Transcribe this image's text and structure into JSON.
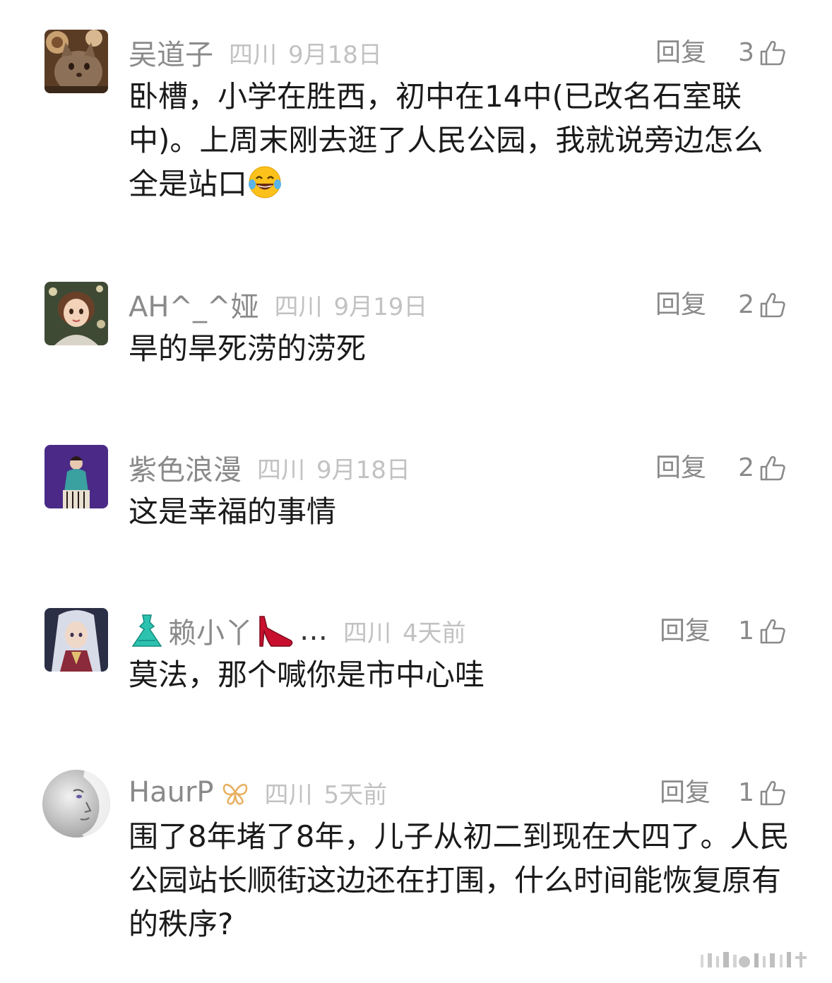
{
  "actions": {
    "reply_label": "回复"
  },
  "comments": [
    {
      "username": "吴道子",
      "location": "四川",
      "date": "9月18日",
      "likes": "3",
      "text": "卧槽，小学在胜西，初中在14中(已改名石室联中)。上周末刚去逛了人民公园，我就说旁边怎么全是站口",
      "emoji": "joy-tears-emoji",
      "avatar": "cat-avatar"
    },
    {
      "username": "AH^_^娅",
      "location": "四川",
      "date": "9月19日",
      "likes": "2",
      "text": "旱的旱死涝的涝死",
      "avatar": "girl-avatar"
    },
    {
      "username": "紫色浪漫",
      "location": "四川",
      "date": "9月18日",
      "likes": "2",
      "text": "这是幸福的事情",
      "avatar": "purple-portrait-avatar"
    },
    {
      "username": "赖小丫",
      "username_prefix_icon": "dress-emoji",
      "username_suffix_icon": "high-heel-emoji",
      "username_ellipsis": "…",
      "location": "四川",
      "date": "4天前",
      "likes": "1",
      "text": "莫法，那个喊你是市中心哇",
      "avatar": "anime-character-avatar"
    },
    {
      "username": "HaurP",
      "badge_icon": "vip-bow-badge-icon",
      "location": "四川",
      "date": "5天前",
      "likes": "1",
      "text": "围了8年堵了8年，儿子从初二到现在大四了。人民公园站长顺街这边还在打围，什么时间能恢复原有的秩序?",
      "avatar": "sketch-face-avatar"
    }
  ],
  "colors": {
    "username": "#8a8a8a",
    "meta": "#c2c2c2",
    "text": "#1a1a1a",
    "background": "#ffffff"
  }
}
